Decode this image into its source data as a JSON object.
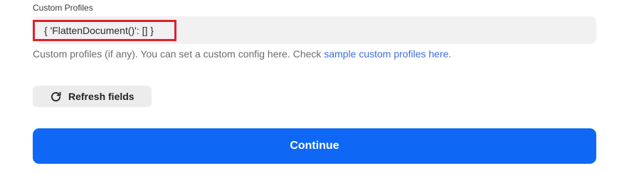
{
  "custom_profiles": {
    "label": "Custom Profiles",
    "value": "{ 'FlattenDocument()': [] }",
    "help_text": "Custom profiles (if any). You can set a custom config here. Check ",
    "help_link": "sample custom profiles here",
    "help_suffix": "."
  },
  "refresh": {
    "label": "Refresh fields",
    "icon": "refresh-icon"
  },
  "continue": {
    "label": "Continue"
  },
  "colors": {
    "highlight_border": "#e0202f",
    "link": "#3f6fd8",
    "primary_button": "#0f68f5"
  }
}
